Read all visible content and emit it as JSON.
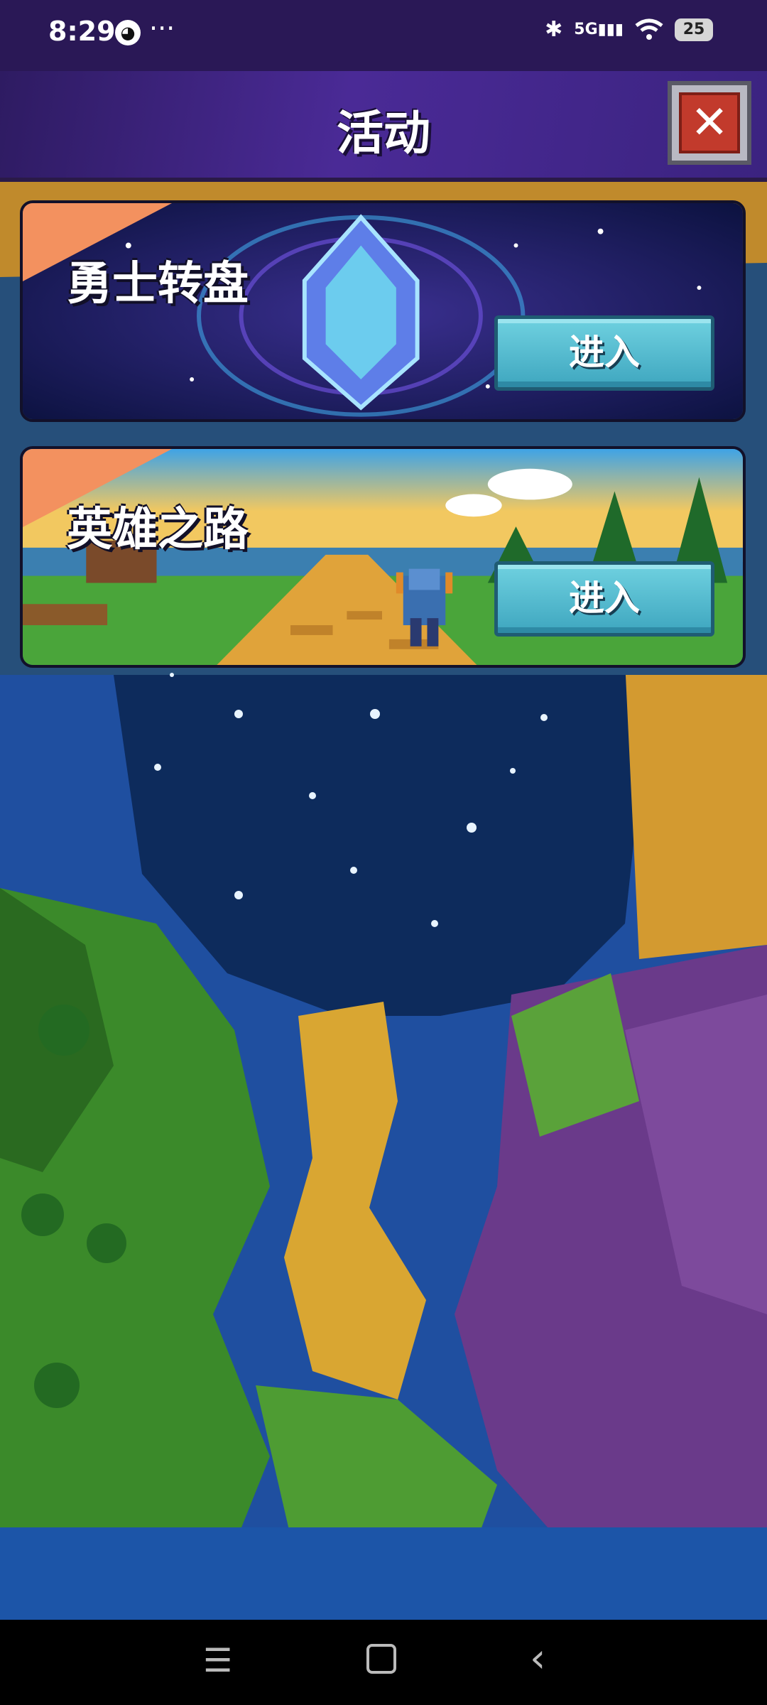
{
  "status_bar": {
    "time": "8:29",
    "qq_icon": "qq-penguin-icon",
    "more": "···",
    "bluetooth": "✱",
    "signal": "5G",
    "wifi": "wifi-icon",
    "battery": "25"
  },
  "header": {
    "title": "活动",
    "close_icon": "close-icon"
  },
  "activities": [
    {
      "title": "勇士转盘",
      "button": "进入",
      "art": "crystal-gem"
    },
    {
      "title": "英雄之路",
      "button": "进入",
      "art": "hero-road"
    }
  ],
  "nav_bar": {
    "menu_icon": "menu-icon",
    "home_icon": "home-icon",
    "back_icon": "back-icon"
  },
  "colors": {
    "header": "#3b2380",
    "corner_tag": "#f3915f",
    "enter_button": "#4fb9cf",
    "close_button": "#c23a2c"
  }
}
